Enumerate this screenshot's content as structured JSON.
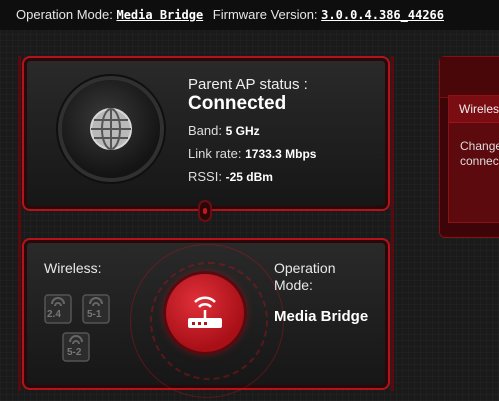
{
  "topbar": {
    "op_mode_label": "Operation Mode:",
    "op_mode_value": "Media Bridge",
    "fw_label": "Firmware Version:",
    "fw_value": "3.0.0.4.386_44266"
  },
  "ap_status": {
    "title": "Parent AP status :",
    "status": "Connected",
    "band_label": "Band:",
    "band_value": "5 GHz",
    "link_rate_label": "Link rate:",
    "link_rate_value": "1733.3 Mbps",
    "rssi_label": "RSSI:",
    "rssi_value": "-25 dBm"
  },
  "wireless_panel": {
    "wireless_label": "Wireless:",
    "bands": [
      "2.4",
      "5-1",
      "5-2"
    ],
    "operation_mode_label": "Operation Mode:",
    "operation_mode_value": "Media Bridge"
  },
  "side_panel": {
    "header": "Wireles",
    "text_line1": "Change",
    "text_line2": "connec"
  },
  "colors": {
    "accent_red": "#b3141b",
    "background": "#1a1a1a"
  }
}
